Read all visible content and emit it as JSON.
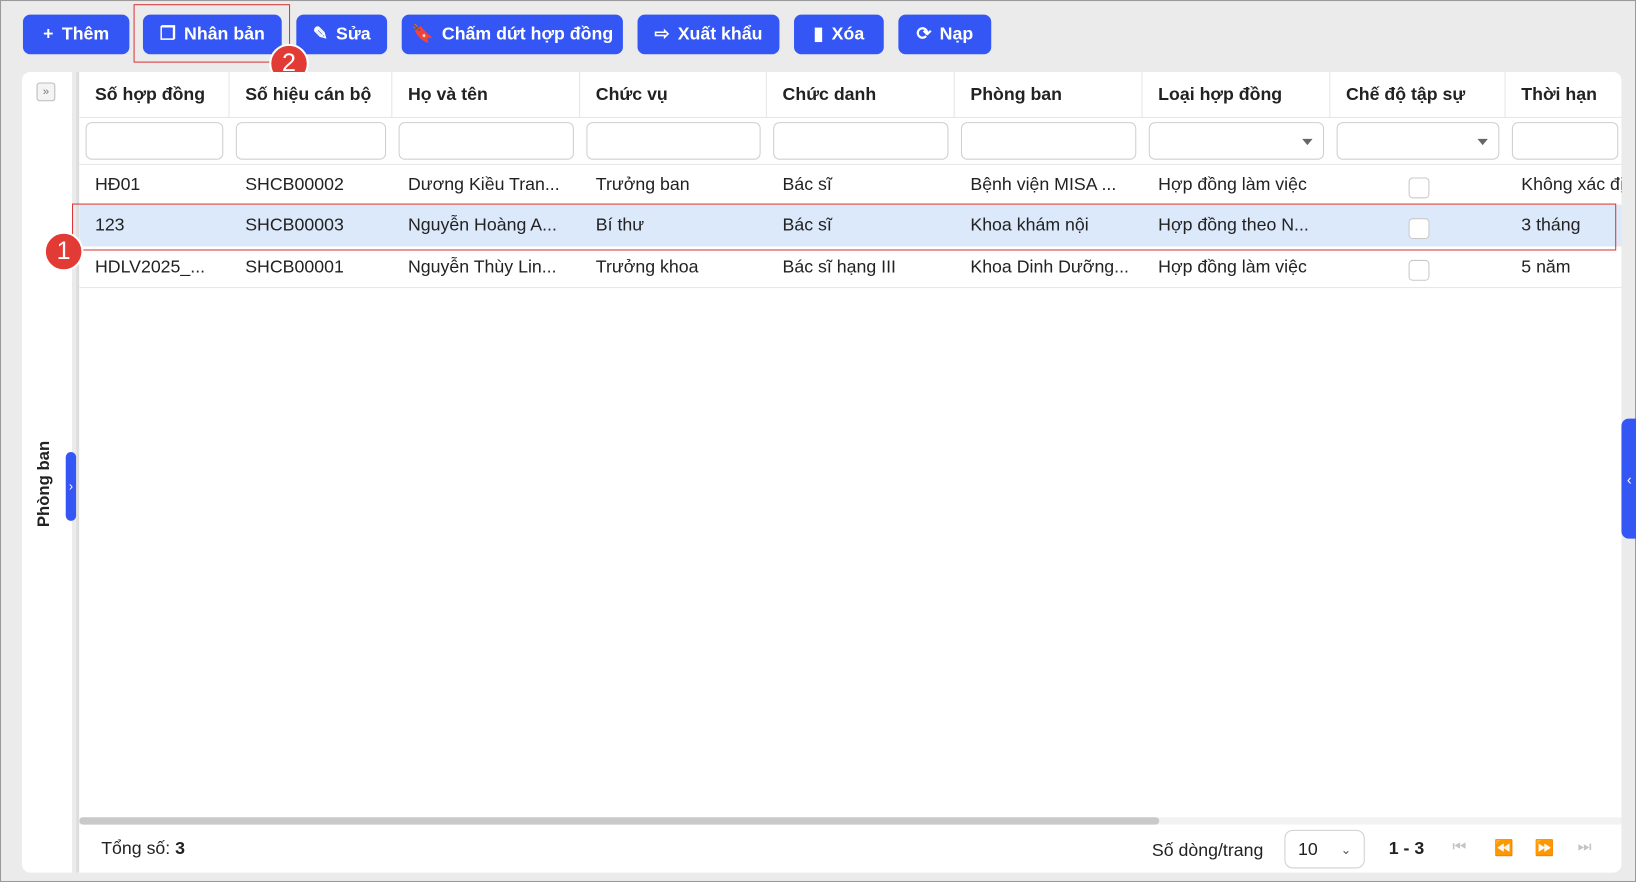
{
  "toolbar": {
    "buttons": [
      {
        "id": "add",
        "label": "Thêm",
        "icon": "plus-icon"
      },
      {
        "id": "duplicate",
        "label": "Nhân bản",
        "icon": "copy-icon"
      },
      {
        "id": "edit",
        "label": "Sửa",
        "icon": "pencil-icon"
      },
      {
        "id": "terminate",
        "label": "Chấm dứt hợp đồng",
        "icon": "document-icon"
      },
      {
        "id": "export",
        "label": "Xuất khẩu",
        "icon": "export-icon"
      },
      {
        "id": "delete",
        "label": "Xóa",
        "icon": "trash-icon"
      },
      {
        "id": "reload",
        "label": "Nạp",
        "icon": "refresh-icon"
      }
    ]
  },
  "annotations": {
    "badge1": "1",
    "badge2": "2"
  },
  "sidebar": {
    "label": "Phòng ban"
  },
  "table": {
    "columns": [
      "Số hợp đồng",
      "Số hiệu cán bộ",
      "Họ và tên",
      "Chức vụ",
      "Chức danh",
      "Phòng ban",
      "Loại hợp đồng",
      "Chế độ tập sự",
      "Thời hạn"
    ],
    "rows": [
      [
        "HĐ01",
        "SHCB00002",
        "Dương Kiều Tran...",
        "Trưởng ban",
        "Bác sĩ",
        "Bệnh viện MISA ...",
        "Hợp đồng làm việc",
        false,
        "Không xác định"
      ],
      [
        "123",
        "SHCB00003",
        "Nguyễn Hoàng A...",
        "Bí thư",
        "Bác sĩ",
        "Khoa khám nội",
        "Hợp đồng theo N...",
        false,
        "3 tháng"
      ],
      [
        "HDLV2025_...",
        "SHCB00001",
        "Nguyễn Thùy Lin...",
        "Trưởng khoa",
        "Bác sĩ hạng III",
        "Khoa Dinh Dưỡng...",
        "Hợp đồng làm việc",
        false,
        "5 năm"
      ]
    ],
    "selected_row": 1
  },
  "footer": {
    "total_label": "Tổng số:",
    "total": "3",
    "rows_per_page_label": "Số dòng/trang",
    "rows_per_page": "10",
    "range": "1 - 3"
  },
  "colors": {
    "accent": "#3456f5",
    "selected": "#dce9fb",
    "annotation": "#e23b35"
  }
}
